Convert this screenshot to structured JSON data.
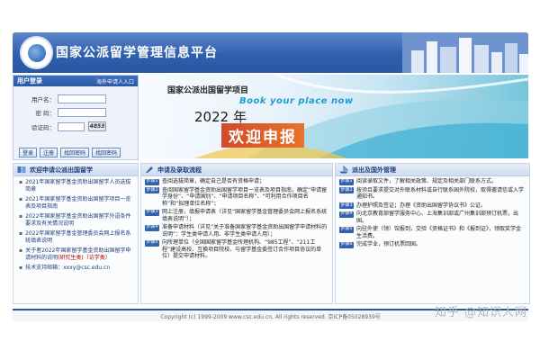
{
  "header": {
    "title": "国家公派留学管理信息平台"
  },
  "login": {
    "title": "用户登录",
    "overseas_link": "海外申请人入口",
    "username_label": "用户名：",
    "password_label": "密 码：",
    "captcha_label": "验证码：",
    "captcha_value": "4853",
    "buttons": [
      "登录",
      "注册",
      "找回密码",
      "找回密码"
    ]
  },
  "banner": {
    "subtitle": "国家公派出国留学项目",
    "slogan": "Book your place now",
    "year": "2022 年",
    "welcome": "欢迎申报"
  },
  "news": {
    "title": "欢迎申请公派出国留学",
    "items": [
      "2021年国家留学基金资助出国留学人员选拔简章",
      "2021年国家留学基金资助出国留学项目一览表及项目指南",
      "2022年国家留学基金资助出国留学外语条件要求及有关情况说明",
      "2022年国家留学基金管理委员会网上报名系统填表说明",
      "关于者2022年国家留学基金资助出国留学申请材料的说明",
      "技术支持邮箱：xxxy@csc.edu.cn"
    ],
    "item5_suffix": "(研究生类)（访学类）"
  },
  "apply": {
    "title": "申请及录取流程",
    "steps": [
      {
        "badge": "步骤1",
        "text": "查阅选拔简章，确定自己是否有资格申请；"
      },
      {
        "badge": "步骤2",
        "text": "查阅国家留学基金资助出国留学项目一览表及项目指南，确定“申请留学身份”、“申请国别”、“申请项目名称”、“可利用合作项目名称”和“拟理单位名称”；"
      },
      {
        "badge": "步骤3",
        "text": "网上注册，填报申请表（详见“国家留学基金管理委员会网上报名系统填表说明”）；"
      },
      {
        "badge": "步骤4",
        "text": "准备申请材料（详见“关于准备国家留学基金资助出国留学申请材料的说明”：学生类申请人用、非学生类申请人用）；"
      },
      {
        "badge": "步骤5",
        "text": "向所理单位（全国国家留学基金所理机构、“985工程”、“211工程”建设高校、互换项目院校、与留学基金委签订合作项目协议的单位）提交申请材料。"
      }
    ]
  },
  "depart": {
    "title": "派出及国外管理",
    "steps": [
      {
        "badge": "步骤1",
        "text": "阅读录取文件，了解相关政策、规定及相关部门联系方式。"
      },
      {
        "badge": "步骤2",
        "text": "按须且要求提交对外联系材料或自行联系国外院校，取得邀请信或入学通知书。"
      },
      {
        "badge": "步骤3",
        "text": "办理护照及签证；办理《资助出国留学协议书》公证。"
      },
      {
        "badge": "步骤4",
        "text": "向北京教育部留学服务中心、上海集训部或广州集训部预订机票，出国。"
      },
      {
        "badge": "步骤5",
        "text": "向驻外使（领）馆报到，交验《资格证书》和《报到证》，领取奖学金生活费。"
      },
      {
        "badge": "步骤6",
        "text": "完成学业，预订机票回国。"
      }
    ]
  },
  "footer": {
    "copyright": "Copyright (c) 1999-2009 www.csc.edu.cn. All rights reserved.  京ICP备05028939号"
  },
  "watermark": {
    "text": "知乎 @知识人网"
  }
}
